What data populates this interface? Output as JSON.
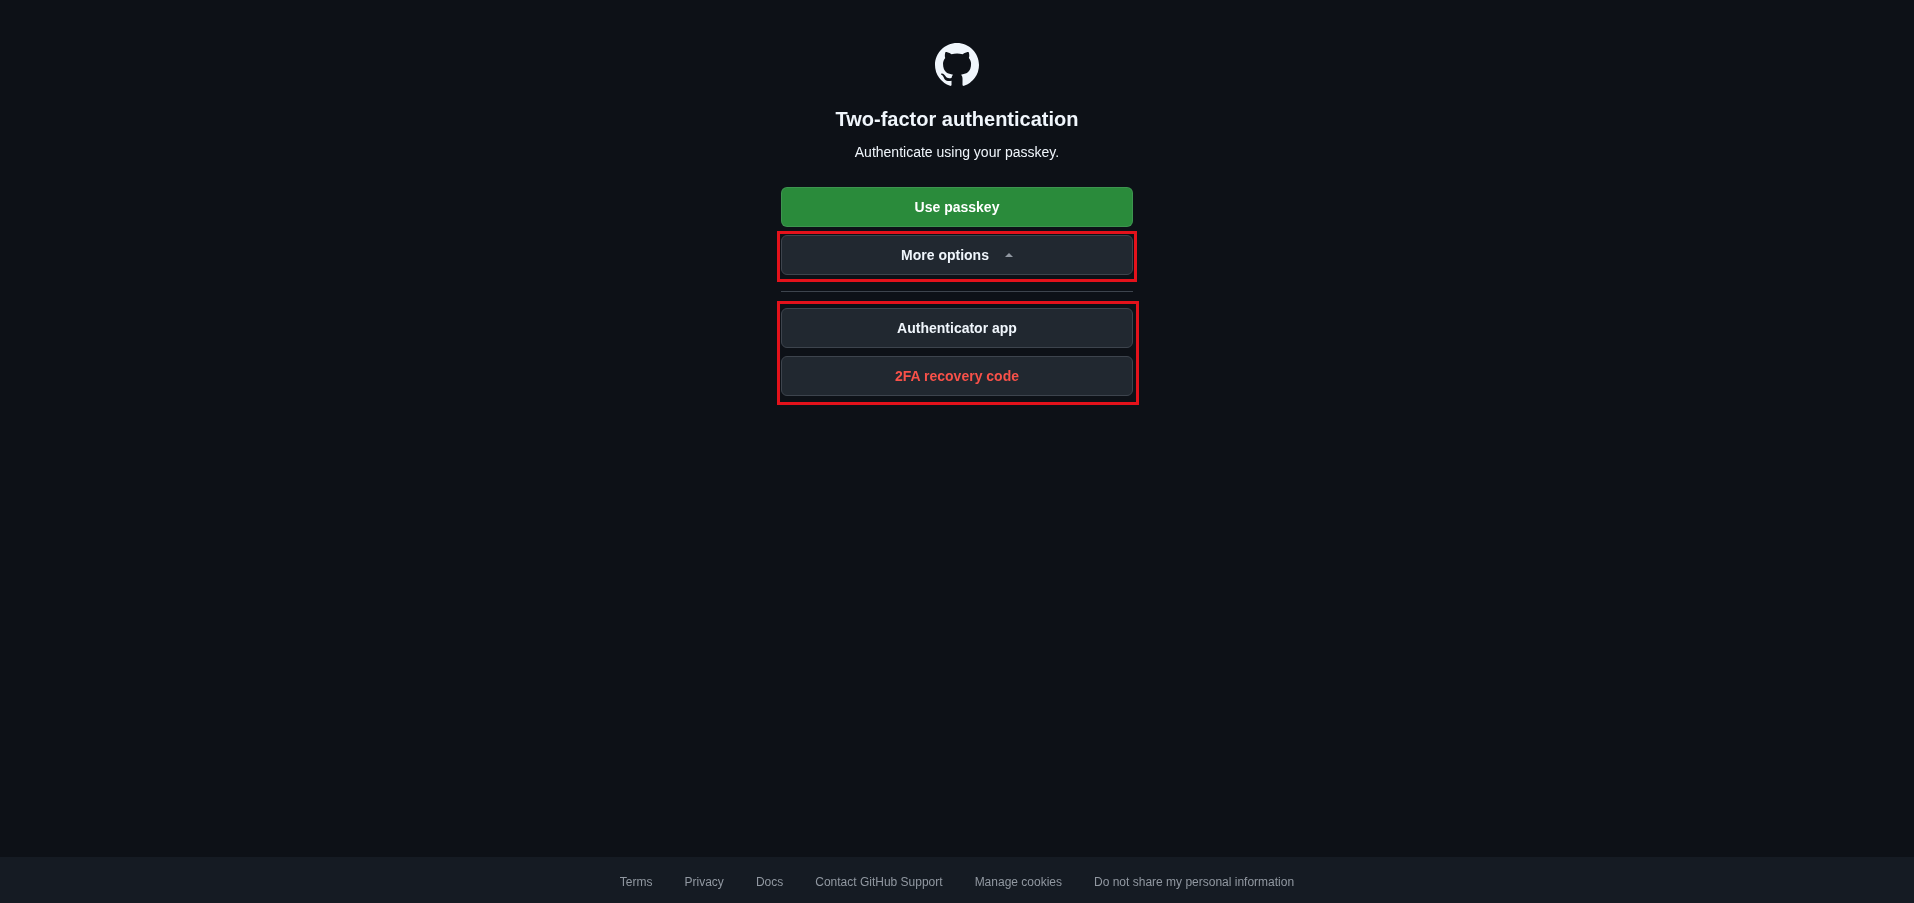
{
  "heading": "Two-factor authentication",
  "subtitle": "Authenticate using your passkey.",
  "primary_button": {
    "label": "Use passkey"
  },
  "more_options": {
    "label": "More options",
    "expanded": true,
    "highlighted": true
  },
  "options": {
    "highlighted": true,
    "items": [
      {
        "label": "Authenticator app",
        "kind": "normal"
      },
      {
        "label": "2FA recovery code",
        "kind": "danger"
      }
    ]
  },
  "footer": {
    "links": [
      "Terms",
      "Privacy",
      "Docs",
      "Contact GitHub Support",
      "Manage cookies",
      "Do not share my personal information"
    ]
  }
}
